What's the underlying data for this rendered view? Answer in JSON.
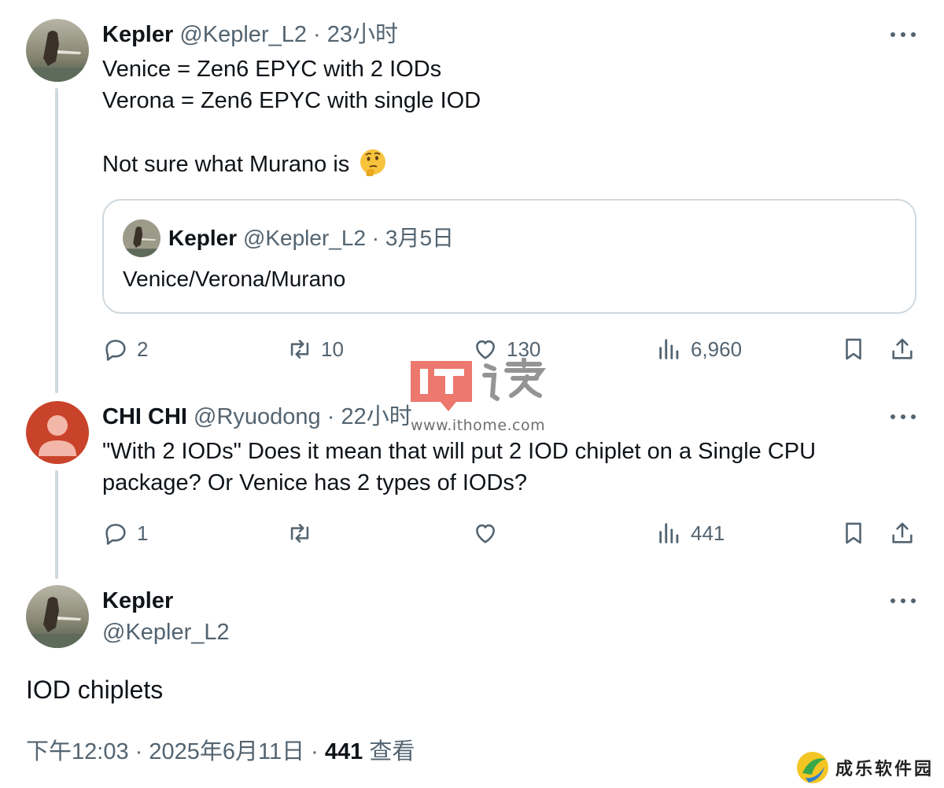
{
  "tweets": [
    {
      "name": "Kepler",
      "handle": "@Kepler_L2",
      "sep": "·",
      "time": "23小时",
      "lines": [
        "Venice = Zen6 EPYC with 2 IODs",
        "Verona = Zen6 EPYC with single IOD",
        "Not sure what Murano is"
      ],
      "emoji": "thinking-face-emoji",
      "quote": {
        "name": "Kepler",
        "handle": "@Kepler_L2",
        "sep": "·",
        "time": "3月5日",
        "text": "Venice/Verona/Murano"
      },
      "actions": {
        "replies": "2",
        "retweets": "10",
        "likes": "130",
        "views": "6,960"
      }
    },
    {
      "name": "CHI CHI",
      "handle": "@Ryuodong",
      "sep": "·",
      "time": "22小时",
      "lines": [
        "\"With 2 IODs\" Does it mean that will put 2 IOD chiplet on a Single CPU",
        "package? Or Venice has 2 types of IODs?"
      ],
      "actions": {
        "replies": "1",
        "retweets": "",
        "likes": "",
        "views": "441"
      }
    }
  ],
  "main_tweet": {
    "name": "Kepler",
    "handle": "@Kepler_L2",
    "text": "IOD chiplets",
    "timestamp": "下午12:03 · 2025年6月11日 · ",
    "views_count": "441",
    "views_label": "查看"
  },
  "watermark": {
    "url": "www.ithome.com",
    "corner_text": "成乐软件园"
  },
  "colors": {
    "text": "#0f1419",
    "secondary": "#536471",
    "border": "#cfd9de",
    "chichi_avatar": "#c9432a",
    "watermark_red": "#e8574b"
  }
}
